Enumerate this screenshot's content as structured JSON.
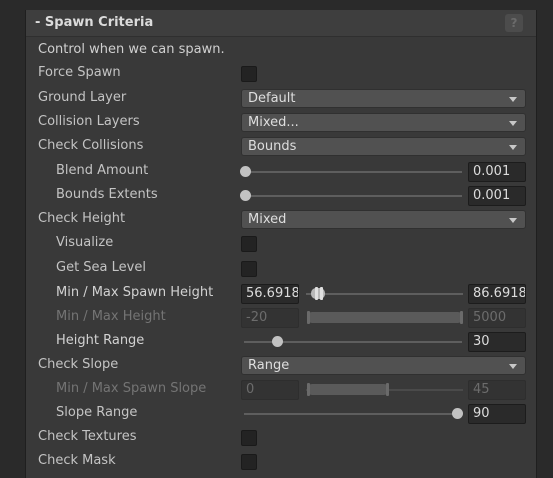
{
  "section": {
    "title": "- Spawn Criteria",
    "help_icon": "?",
    "description": "Control when we can spawn."
  },
  "fields": {
    "force_spawn": {
      "label": "Force Spawn",
      "checked": false
    },
    "ground_layer": {
      "label": "Ground Layer",
      "value": "Default"
    },
    "collision_layers": {
      "label": "Collision Layers",
      "value": "Mixed..."
    },
    "check_collisions": {
      "label": "Check Collisions",
      "value": "Bounds"
    },
    "blend_amount": {
      "label": "Blend Amount",
      "value": "0.001",
      "fraction": 0.001
    },
    "bounds_extents": {
      "label": "Bounds Extents",
      "value": "0.001",
      "fraction": 0.001
    },
    "check_height": {
      "label": "Check Height",
      "value": "Mixed"
    },
    "visualize": {
      "label": "Visualize",
      "checked": false
    },
    "get_sea_level": {
      "label": "Get Sea Level",
      "checked": false
    },
    "min_max_spawn_height": {
      "label": "Min / Max Spawn Height",
      "min": "56.6918",
      "max": "86.6918"
    },
    "min_max_height": {
      "label": "Min / Max Height",
      "min": "-20",
      "max": "5000"
    },
    "height_range": {
      "label": "Height Range",
      "value": "30"
    },
    "check_slope": {
      "label": "Check Slope",
      "value": "Range"
    },
    "min_max_spawn_slope": {
      "label": "Min / Max Spawn Slope",
      "min": "0",
      "max": "45"
    },
    "slope_range": {
      "label": "Slope Range",
      "value": "90"
    },
    "check_textures": {
      "label": "Check Textures",
      "checked": false
    },
    "check_mask": {
      "label": "Check Mask",
      "checked": false
    }
  },
  "colors": {
    "panel": "#393939",
    "field": "#2a2a2a",
    "dropdown": "#515151",
    "text": "#c4c4c4"
  }
}
